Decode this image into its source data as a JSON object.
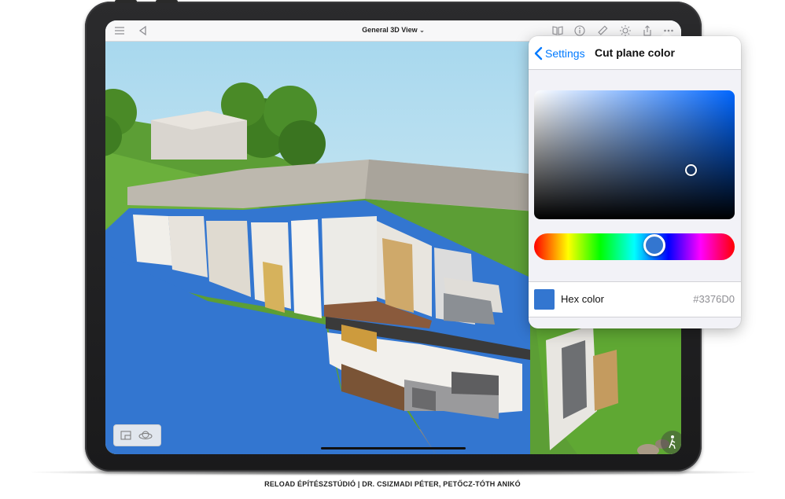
{
  "navbar": {
    "title": "General 3D View",
    "icons": [
      "list-icon",
      "back-triangle-icon",
      "book-icon",
      "info-icon",
      "ruler-icon",
      "sun-icon",
      "share-icon",
      "more-icon"
    ]
  },
  "popover": {
    "back_label": "Settings",
    "title": "Cut plane color",
    "hex_label": "Hex color",
    "hex_value": "#3376D0",
    "hue_fraction": 0.6
  },
  "colors": {
    "cut_plane": "#3376D0",
    "ios_blue": "#007aff"
  },
  "caption": "RELOAD ÉPÍTÉSZSTÚDIÓ | DR. CSIZMADI PÉTER, PETŐCZ-TÓTH ANIKÓ"
}
